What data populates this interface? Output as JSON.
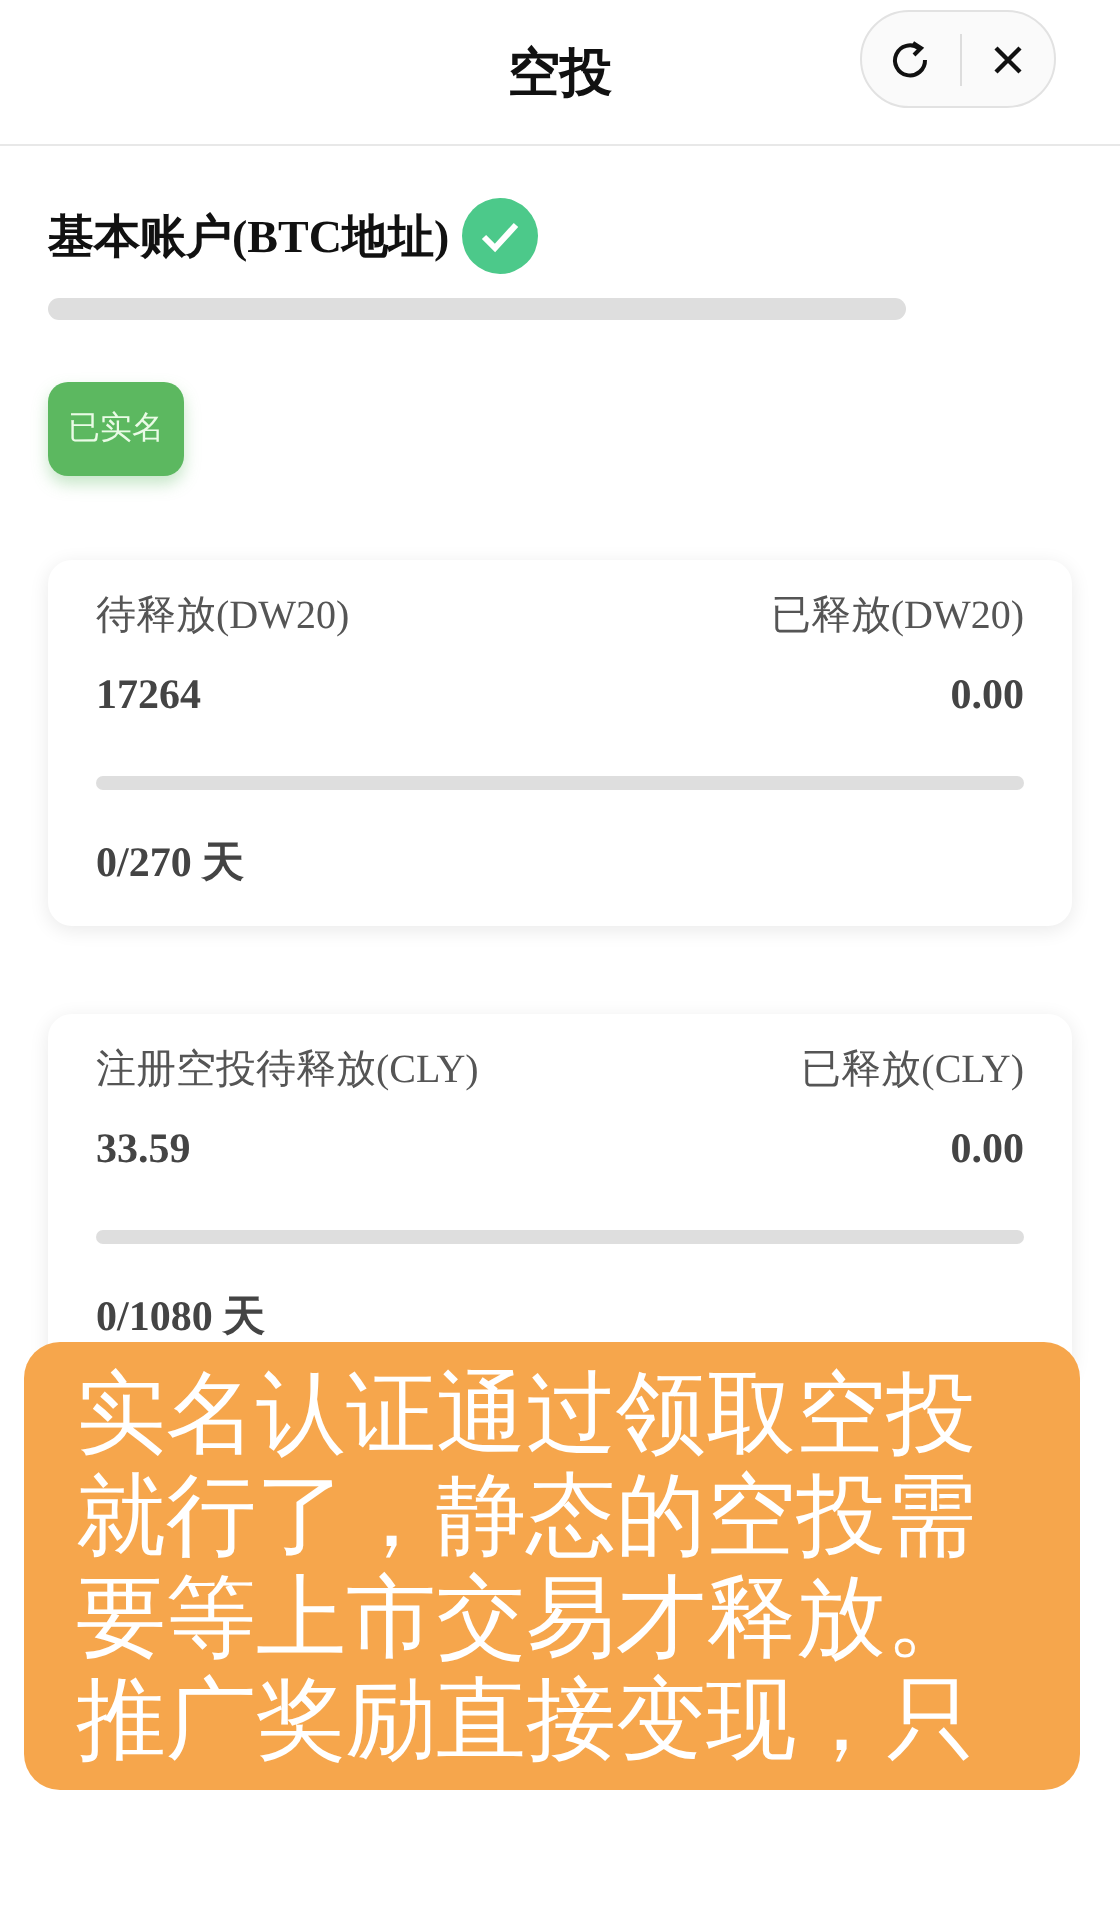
{
  "header": {
    "title": "空投"
  },
  "account": {
    "title": "基本账户(BTC地址)",
    "verified": true,
    "level": 0,
    "badge": "已实名"
  },
  "cards": [
    {
      "left_label": "待释放(DW20)",
      "right_label": "已释放(DW20)",
      "left_value": "17264",
      "right_value": "0.00",
      "level": 0,
      "days": "0/270 天"
    },
    {
      "left_label": "注册空投待释放(CLY)",
      "right_label": "已释放(CLY)",
      "left_value": "33.59",
      "right_value": "0.00",
      "level": 0,
      "days": "0/1080 天"
    }
  ],
  "caption": {
    "lines": [
      "实名认证通过领取空投",
      "就行了，静态的空投需",
      "要等上市交易才释放。",
      "推广奖励直接变现，只"
    ]
  }
}
